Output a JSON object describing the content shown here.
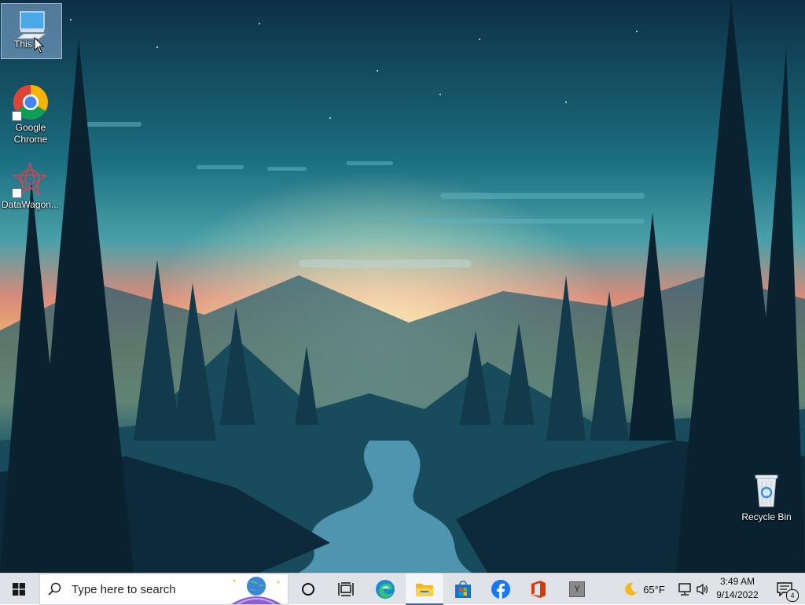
{
  "desktop": {
    "icons": [
      {
        "label": "This PC",
        "visible_label": "This",
        "icon": "computer-icon",
        "selected": true
      },
      {
        "label": "Google Chrome",
        "icon": "chrome-icon"
      },
      {
        "label": "DataWagon...",
        "icon": "datawagon-icon"
      },
      {
        "label": "Recycle Bin",
        "icon": "recycle-bin-icon"
      }
    ]
  },
  "taskbar": {
    "search_placeholder": "Type here to search",
    "apps": [
      {
        "name": "Cortana",
        "icon": "cortana-circle-icon"
      },
      {
        "name": "Task View",
        "icon": "task-view-icon"
      },
      {
        "name": "Microsoft Edge",
        "icon": "edge-icon"
      },
      {
        "name": "File Explorer",
        "icon": "file-explorer-icon",
        "active": true
      },
      {
        "name": "Microsoft Store",
        "icon": "store-icon"
      },
      {
        "name": "Facebook",
        "icon": "facebook-icon"
      },
      {
        "name": "Office",
        "icon": "office-icon"
      },
      {
        "name": "Y App",
        "icon": "y-app-icon",
        "label": "Y"
      }
    ],
    "tray": {
      "weather": {
        "temp": "65°F",
        "icon": "moon-icon"
      },
      "time": "3:49 AM",
      "date": "9/14/2022",
      "notifications": "4"
    }
  },
  "colors": {
    "taskbar": "#dfe3e8",
    "accent": "#2b6cb0"
  }
}
